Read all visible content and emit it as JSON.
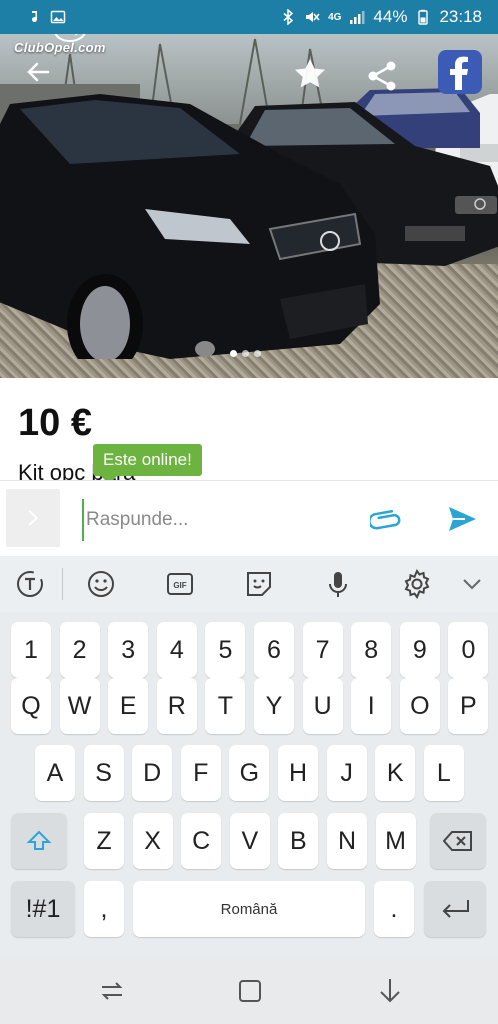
{
  "status_bar": {
    "signal_label": "4G",
    "battery": "44%",
    "time": "23:18"
  },
  "photo": {
    "logo_text": "ClubOpel.com",
    "page_count": 3,
    "active_page": 1
  },
  "listing": {
    "price": "10 €",
    "title": "Kit opc bara"
  },
  "online_tooltip": "Este online!",
  "reply": {
    "placeholder": "Raspunde..."
  },
  "keyboard": {
    "row_numbers": [
      "1",
      "2",
      "3",
      "4",
      "5",
      "6",
      "7",
      "8",
      "9",
      "0"
    ],
    "row_q": [
      "Q",
      "W",
      "E",
      "R",
      "T",
      "Y",
      "U",
      "I",
      "O",
      "P"
    ],
    "row_a": [
      "A",
      "S",
      "D",
      "F",
      "G",
      "H",
      "J",
      "K",
      "L"
    ],
    "row_z": [
      "Z",
      "X",
      "C",
      "V",
      "B",
      "N",
      "M"
    ],
    "symbols_key": "!#1",
    "comma_key": ",",
    "space_key": "Română",
    "period_key": ".",
    "gif_label": "GIF"
  },
  "colors": {
    "status_bar": "#1d7ea6",
    "online_green": "#6db33f",
    "accent_blue": "#2aa5d6",
    "facebook": "#3b5bb5"
  },
  "icons": {
    "back": "arrow-left-icon",
    "favorite": "star-icon",
    "share": "share-icon",
    "facebook": "facebook-icon",
    "attach": "paperclip-icon",
    "send": "send-icon"
  }
}
